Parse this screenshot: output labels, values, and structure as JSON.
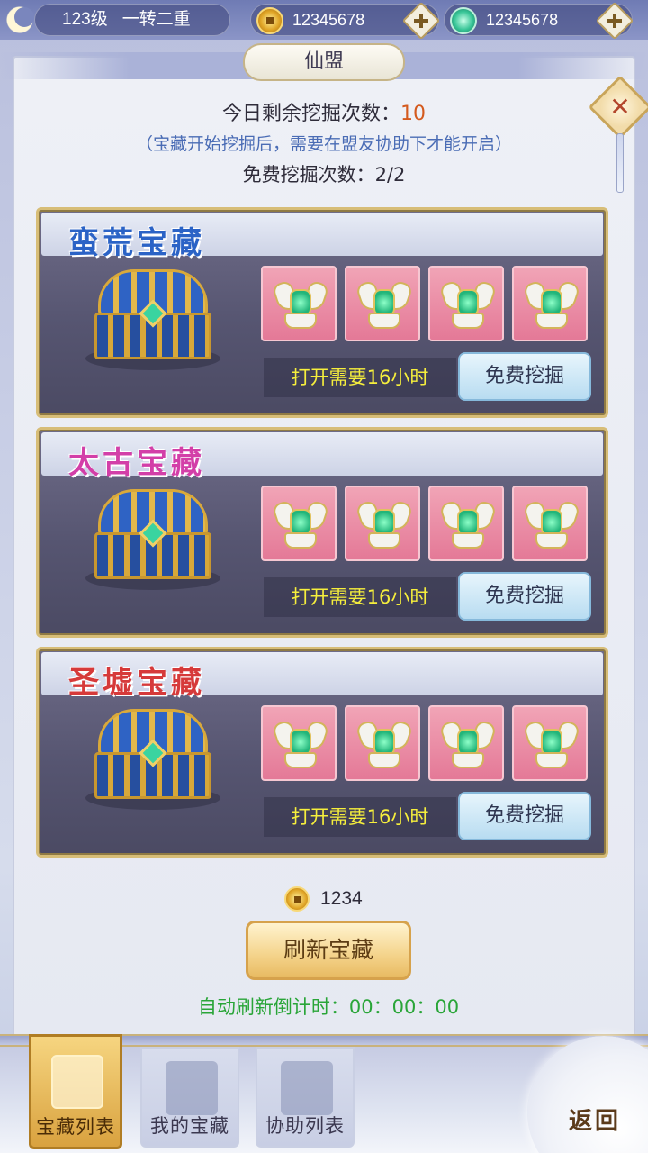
{
  "topbar": {
    "level": "123级",
    "rank": "一转二重",
    "gold_amount": "12345678",
    "jade_amount": "12345678",
    "gold_icon": "coin-icon",
    "jade_icon": "jade-icon",
    "plus_icon": "plus-icon"
  },
  "window": {
    "title": "仙盟",
    "close_icon": "close-icon",
    "close_glyph": "✕"
  },
  "info": {
    "remaining_label": "今日剩余挖掘次数：",
    "remaining_value": "10",
    "note": "（宝藏开始挖掘后，需要在盟友协助下才能开启）",
    "free_label": "免费挖掘次数：",
    "free_value": "2/2"
  },
  "treasures": [
    {
      "name": "蛮荒宝藏",
      "title_color": "#2b63c6",
      "open_time": "打开需要16小时",
      "button": "免费挖掘",
      "rewards": [
        "armor-icon",
        "armor-icon",
        "armor-icon",
        "armor-icon"
      ]
    },
    {
      "name": "太古宝藏",
      "title_color": "#d33fa8",
      "open_time": "打开需要16小时",
      "button": "免费挖掘",
      "rewards": [
        "armor-icon",
        "armor-icon",
        "armor-icon",
        "armor-icon"
      ]
    },
    {
      "name": "圣墟宝藏",
      "title_color": "#d63a3a",
      "open_time": "打开需要16小时",
      "button": "免费挖掘",
      "rewards": [
        "armor-icon",
        "armor-icon",
        "armor-icon",
        "armor-icon"
      ]
    }
  ],
  "refresh": {
    "cost": "1234",
    "button": "刷新宝藏",
    "countdown_label": "自动刷新倒计时：",
    "countdown_value": "00：00：00"
  },
  "tabs": [
    {
      "label": "宝藏列表",
      "active": true
    },
    {
      "label": "我的宝藏",
      "active": false
    },
    {
      "label": "协助列表",
      "active": false
    }
  ],
  "back": {
    "label": "返回"
  },
  "colors": {
    "accent_gold": "#d6a24c",
    "count_highlight": "#d45a1e",
    "note_blue": "#4a6cb5",
    "countdown_green": "#29a538",
    "open_time_yellow": "#f6ef3c"
  }
}
